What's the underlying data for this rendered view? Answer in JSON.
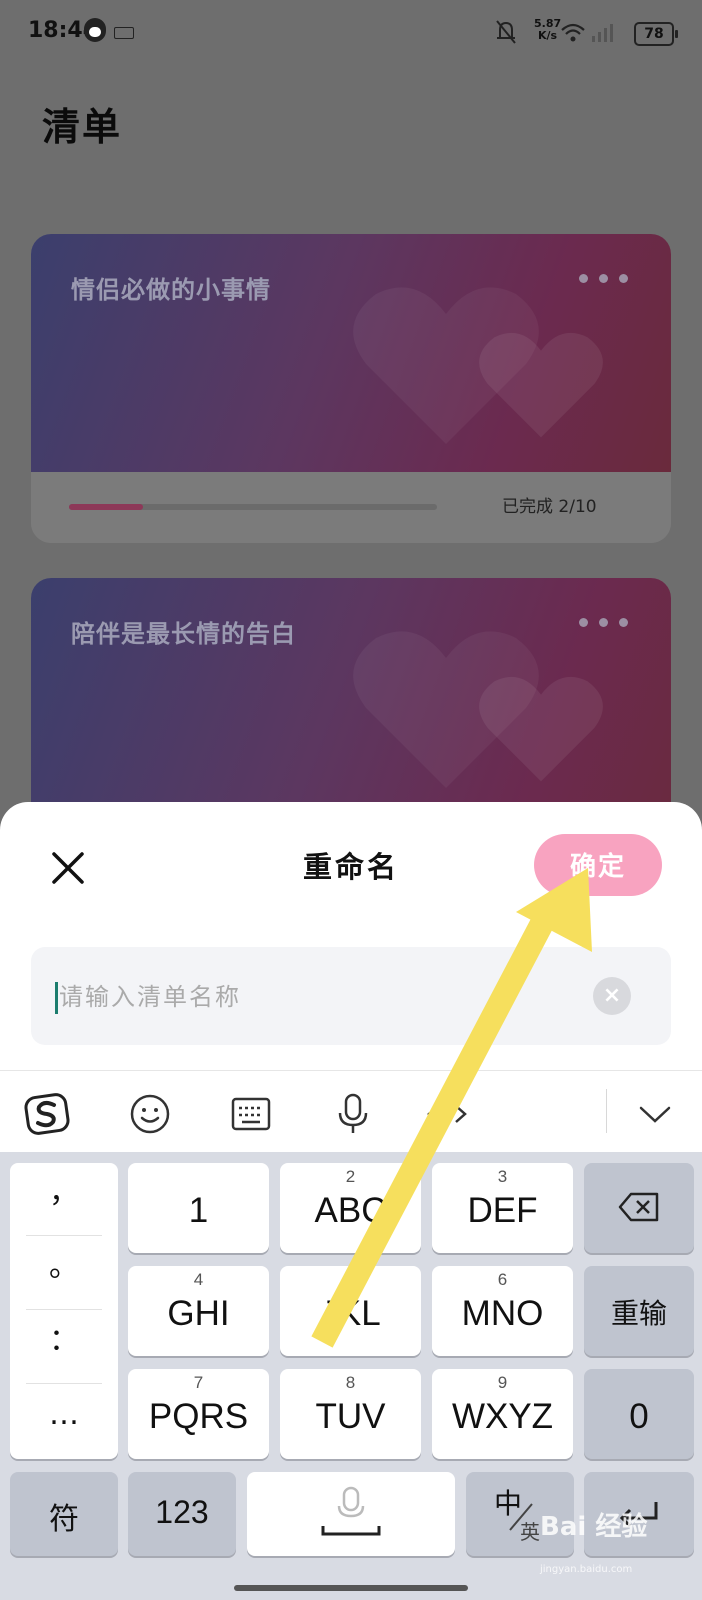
{
  "status_bar": {
    "time": "18:44",
    "net_speed_value": "5.87",
    "net_speed_unit": "K/s",
    "battery": "78"
  },
  "page": {
    "title": "清单"
  },
  "cards": [
    {
      "title": "情侣必做的小事情",
      "progress_label": "已完成",
      "progress_count": "2/10",
      "progress_fraction": 0.2
    },
    {
      "title": "陪伴是最长情的告白"
    }
  ],
  "rename_sheet": {
    "title": "重命名",
    "confirm_label": "确定",
    "input_placeholder": "请输入清单名称",
    "input_value": ""
  },
  "keyboard": {
    "toolbar_icons": [
      "sogou-logo-icon",
      "emoji-icon",
      "keyboard-icon",
      "microphone-icon",
      "cursor-move-icon",
      "collapse-keyboard-icon"
    ],
    "punctuation": [
      "，",
      "。",
      "：",
      "…"
    ],
    "keys_row1": [
      {
        "num": "",
        "label": "1"
      },
      {
        "num": "2",
        "label": "ABC"
      },
      {
        "num": "3",
        "label": "DEF"
      }
    ],
    "keys_row2": [
      {
        "num": "4",
        "label": "GHI"
      },
      {
        "num": "5",
        "label": "JKL"
      },
      {
        "num": "6",
        "label": "MNO"
      }
    ],
    "keys_row3": [
      {
        "num": "7",
        "label": "PQRS"
      },
      {
        "num": "8",
        "label": "TUV"
      },
      {
        "num": "9",
        "label": "WXYZ"
      }
    ],
    "reinput_label": "重输",
    "zero_label": "0",
    "symbol_label": "符",
    "numbers_label": "123",
    "lang_zh": "中",
    "lang_en": "英"
  },
  "colors": {
    "accent_pink": "#f8a3c0",
    "arrow_yellow": "#f6df5d",
    "overlay_gray": "#6e6e6e"
  },
  "watermark": {
    "text": "Bai 经验",
    "sub": "jingyan.baidu.com"
  }
}
